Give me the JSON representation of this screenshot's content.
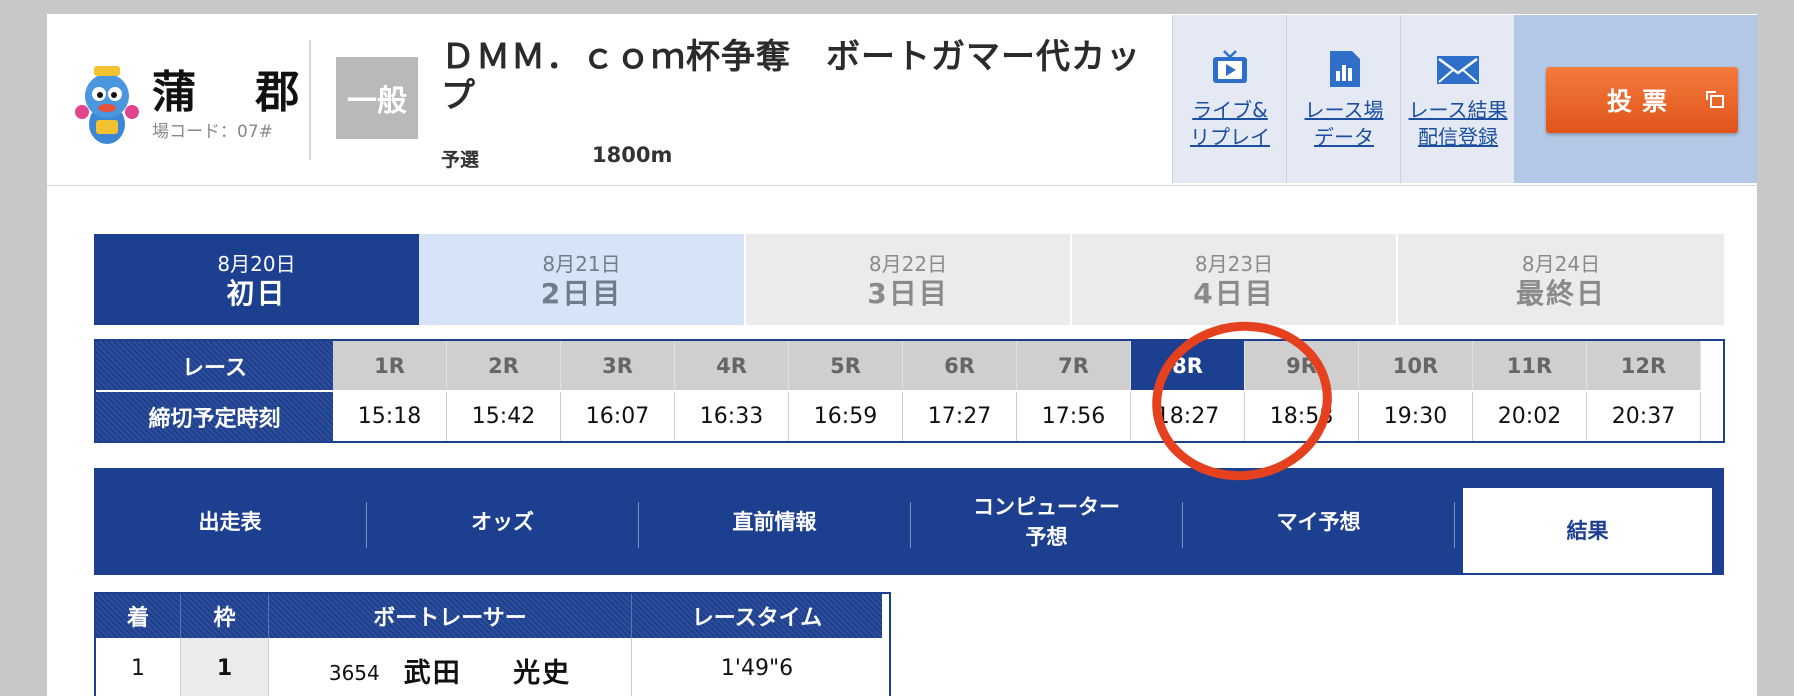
{
  "header": {
    "venue_name": "蒲 郡",
    "venue_code": "場コード：07#",
    "grade_badge": "一般",
    "race_title": "ＤＭＭ．ｃｏｍ杯争奪　ボートガマー代カップ",
    "race_class": "予選",
    "race_distance": "1800m",
    "links": [
      {
        "label_1": "ライブ&",
        "label_2": "リプレイ",
        "icon": "tv-play-icon"
      },
      {
        "label_1": "レース場",
        "label_2": "データ",
        "icon": "document-chart-icon"
      },
      {
        "label_1": "レース結果",
        "label_2": "配信登録",
        "icon": "mail-icon"
      }
    ],
    "vote_label": "投票"
  },
  "days": [
    {
      "date": "8月20日",
      "name": "初日",
      "state": "active"
    },
    {
      "date": "8月21日",
      "name": "2日目",
      "state": "next"
    },
    {
      "date": "8月22日",
      "name": "3日目",
      "state": "disabled"
    },
    {
      "date": "8月23日",
      "name": "4日目",
      "state": "disabled"
    },
    {
      "date": "8月24日",
      "name": "最終日",
      "state": "disabled"
    }
  ],
  "race_grid": {
    "race_header": "レース",
    "deadline_header": "締切予定時刻",
    "races": [
      {
        "no": "1R",
        "time": "15:18"
      },
      {
        "no": "2R",
        "time": "15:42"
      },
      {
        "no": "3R",
        "time": "16:07"
      },
      {
        "no": "4R",
        "time": "16:33"
      },
      {
        "no": "5R",
        "time": "16:59"
      },
      {
        "no": "6R",
        "time": "17:27"
      },
      {
        "no": "7R",
        "time": "17:56"
      },
      {
        "no": "8R",
        "time": "18:27"
      },
      {
        "no": "9R",
        "time": "18:58"
      },
      {
        "no": "10R",
        "time": "19:30"
      },
      {
        "no": "11R",
        "time": "20:02"
      },
      {
        "no": "12R",
        "time": "20:37"
      }
    ],
    "current_race": "8R",
    "highlight_color": "#e5411f"
  },
  "content_tabs": [
    {
      "label": "出走表"
    },
    {
      "label": "オッズ"
    },
    {
      "label": "直前情報"
    },
    {
      "label_1": "コンピューター",
      "label_2": "予想"
    },
    {
      "label": "マイ予想"
    },
    {
      "label": "結果"
    }
  ],
  "selected_tab": "結果",
  "results": {
    "headers": [
      "着",
      "枠",
      "ボートレーサー",
      "レースタイム"
    ],
    "rows": [
      {
        "place": "1",
        "frame": "1",
        "racer_id": "3654",
        "racer_name": "武田 光史",
        "time": "1'49\"6"
      }
    ]
  },
  "colors": {
    "primary": "#1d3f8f",
    "vote": "#e86a2a",
    "link": "#1c4fa0"
  }
}
